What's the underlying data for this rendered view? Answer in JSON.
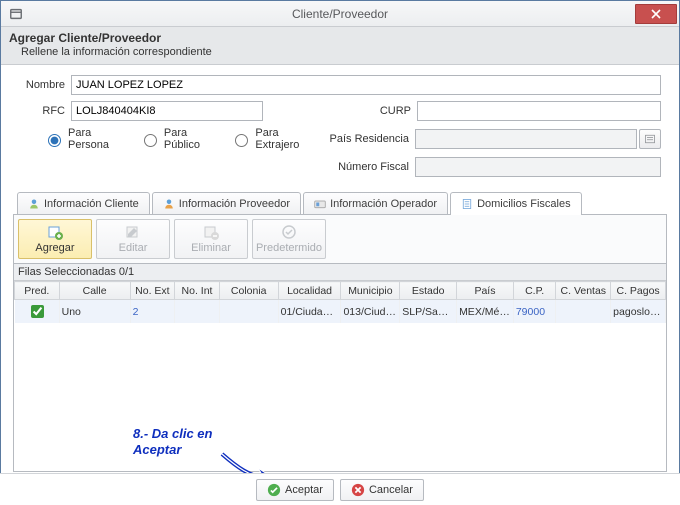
{
  "window": {
    "title": "Cliente/Proveedor"
  },
  "header": {
    "title": "Agregar Cliente/Proveedor",
    "subtitle": "Rellene la información correspondiente"
  },
  "form": {
    "nombre_label": "Nombre",
    "nombre_value": "JUAN LOPEZ LOPEZ",
    "rfc_label": "RFC",
    "rfc_value": "LOLJ840404KI8",
    "curp_label": "CURP",
    "curp_value": "",
    "residencia_label": "País Residencia",
    "residencia_value": "",
    "fiscal_label": "Número Fiscal",
    "fiscal_value": "",
    "radios": {
      "persona": "Para Persona",
      "publico": "Para Público",
      "extranjero": "Para Extrajero"
    }
  },
  "tabs": [
    {
      "label": "Información Cliente"
    },
    {
      "label": "Información Proveedor"
    },
    {
      "label": "Información Operador"
    },
    {
      "label": "Domicilios Fiscales"
    }
  ],
  "toolbar": {
    "agregar": "Agregar",
    "editar": "Editar",
    "eliminar": "Eliminar",
    "predeterminado": "Predetermido"
  },
  "grid": {
    "status": "Filas Seleccionadas  0/1",
    "headers": {
      "pred": "Pred.",
      "calle": "Calle",
      "noext": "No. Ext",
      "noint": "No. Int",
      "colonia": "Colonia",
      "localidad": "Localidad",
      "municipio": "Municipio",
      "estado": "Estado",
      "pais": "País",
      "cp": "C.P.",
      "cventas": "C. Ventas",
      "cpagos": "C. Pagos"
    },
    "row": {
      "calle": "Uno",
      "noext": "2",
      "noint": "",
      "colonia": "",
      "localidad": "01/Ciuda…",
      "municipio": "013/Ciud…",
      "estado": "SLP/San L…",
      "pais": "MEX/Méx…",
      "cp": "79000",
      "cventas": "",
      "cpagos": "pagoslop…"
    }
  },
  "annotation": {
    "line1": "8.- Da clic en",
    "line2": "Aceptar"
  },
  "footer": {
    "aceptar": "Aceptar",
    "cancelar": "Cancelar"
  }
}
